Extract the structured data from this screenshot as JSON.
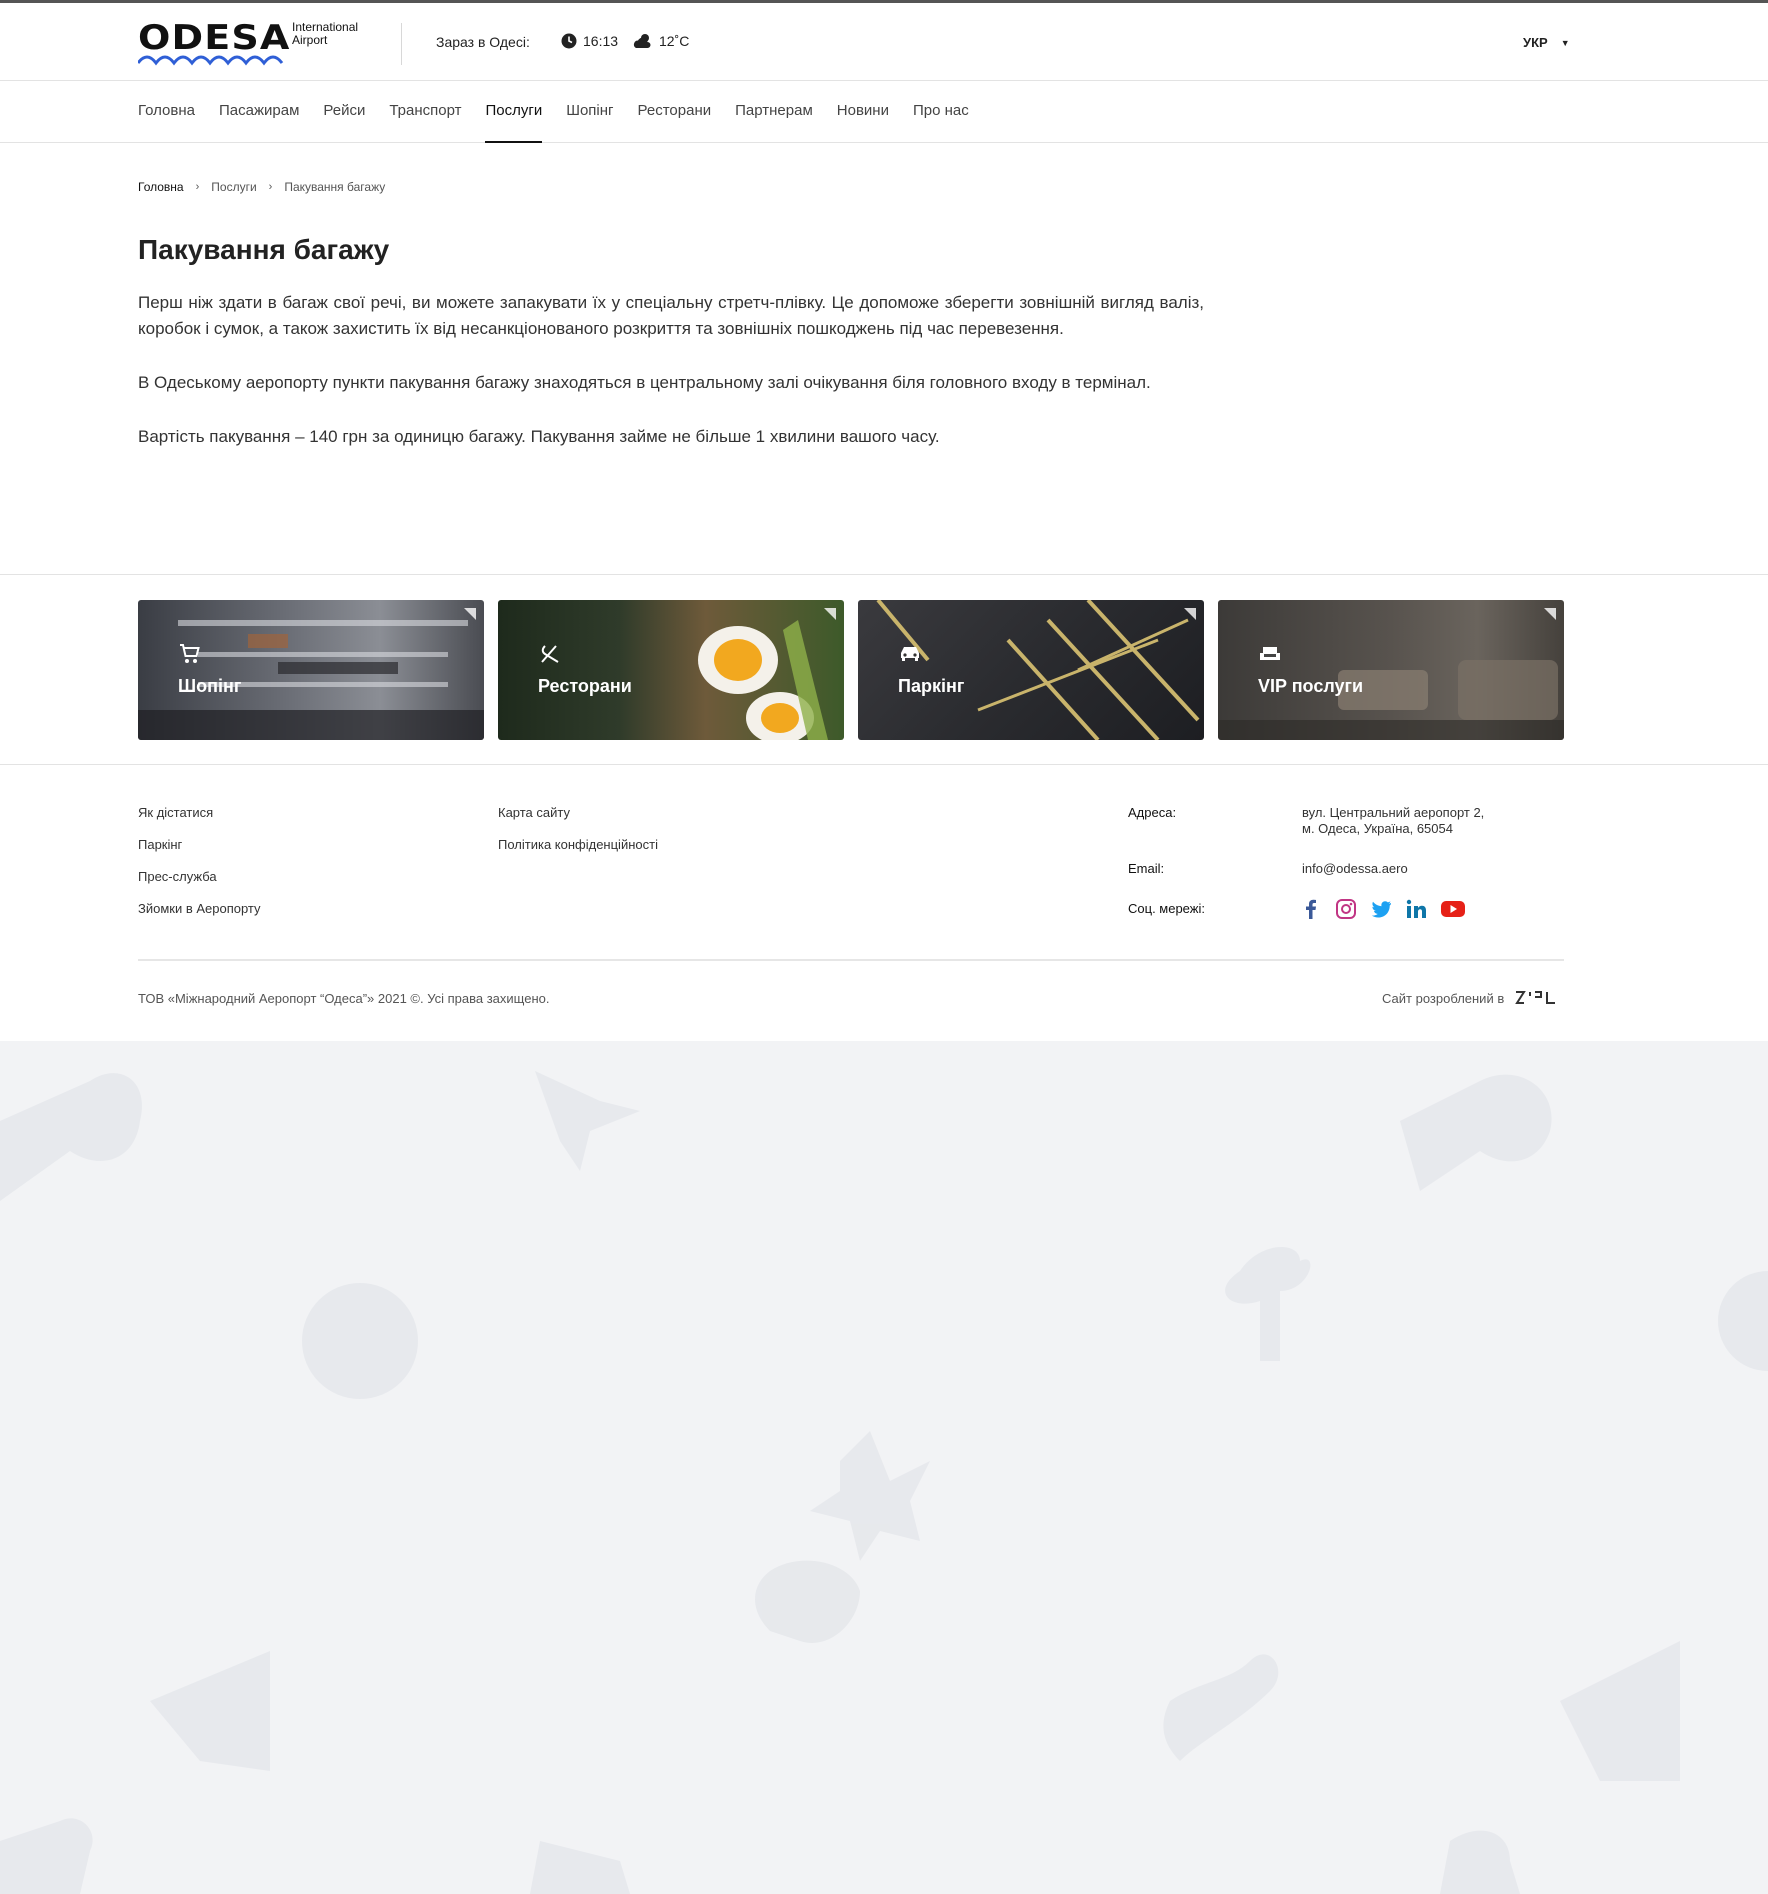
{
  "header": {
    "logo_text": "ODESA",
    "logo_sub_1": "International",
    "logo_sub_2": "Airport",
    "now_label": "Зараз в Одесі:",
    "time": "16:13",
    "temperature": "12˚C",
    "language": "УКР"
  },
  "nav": {
    "items": [
      "Головна",
      "Пасажирам",
      "Рейси",
      "Транспорт",
      "Послуги",
      "Шопінг",
      "Ресторани",
      "Партнерам",
      "Новини",
      "Про нас"
    ],
    "active_index": 4
  },
  "breadcrumb": [
    "Головна",
    "Послуги",
    "Пакування багажу"
  ],
  "page": {
    "title": "Пакування багажу",
    "paragraphs": [
      "Перш ніж здати в багаж свої речі, ви можете запакувати їх у спеціальну стретч-плівку. Це допоможе зберегти зовнішній вигляд валіз, коробок і сумок, а також захистить їх від несанкціонованого розкриття та зовнішніх пошкоджень під час перевезення.",
      "В Одеському аеропорту пункти пакування багажу знаходяться в центральному залі очікування біля головного входу в термінал.",
      "Вартість пакування – 140 грн за одиницю багажу. Пакування займе не більше 1 хвилини вашого часу."
    ]
  },
  "cards": [
    {
      "label": "Шопінг",
      "icon": "cart-icon"
    },
    {
      "label": "Ресторани",
      "icon": "cutlery-icon"
    },
    {
      "label": "Паркінг",
      "icon": "car-icon"
    },
    {
      "label": "VIP послуги",
      "icon": "sofa-icon"
    }
  ],
  "footer": {
    "col1": [
      "Як дістатися",
      "Паркінг",
      "Прес-служба",
      "Зйомки в Аеропорту"
    ],
    "col2": [
      "Карта сайту",
      "Політика конфіденційності"
    ],
    "address_label": "Адреса:",
    "address_line1": "вул. Центральний аеропорт 2,",
    "address_line2": "м. Одеса, Україна, 65054",
    "email_label": "Email:",
    "email": "info@odessa.aero",
    "social_label": "Соц. мережі:",
    "social": [
      "facebook-icon",
      "instagram-icon",
      "twitter-icon",
      "linkedin-icon",
      "youtube-icon"
    ],
    "copyright": "ТОВ «Міжнародний Аеропорт “Одеса”» 2021 ©. Усі права захищено.",
    "developer_label": "Сайт розроблений в"
  },
  "colors": {
    "accent_blue": "#2f5fd6",
    "facebook": "#3b5998",
    "instagram": "#c13584",
    "twitter": "#1da1f2",
    "linkedin": "#0e76a8",
    "youtube": "#e62117"
  }
}
